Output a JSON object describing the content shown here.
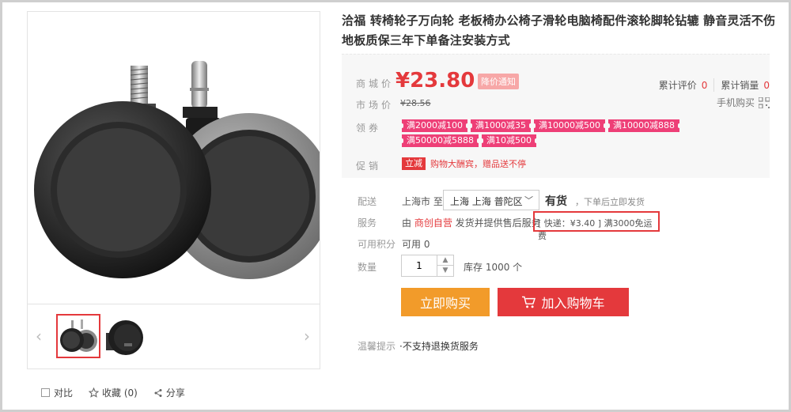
{
  "product": {
    "title": "洽福 转椅轮子万向轮 老板椅办公椅子滑轮电脑椅配件滚轮脚轮钻辘 静音灵活不伤地板质保三年下单备注安装方式"
  },
  "gallery": {
    "prev_icon": "chevron-left-icon",
    "next_icon": "chevron-right-icon"
  },
  "actions": {
    "compare": "对比",
    "favorite": "收藏 (0)",
    "share": "分享"
  },
  "price": {
    "label": "商城价",
    "value": "¥23.80",
    "notice": "降价通知",
    "market_label": "市场价",
    "market_value": "¥28.56"
  },
  "stats": {
    "reviews_label": "累计评价",
    "reviews_count": "0",
    "sales_label": "累计销量",
    "sales_count": "0",
    "mobile_buy": "手机购买"
  },
  "coupons": {
    "label": "领券",
    "items": [
      "满2000减100",
      "满1000减35",
      "满10000减500",
      "满10000减888",
      "满50000减5888",
      "满10减500"
    ]
  },
  "promotion": {
    "label": "促销",
    "tag": "立减",
    "text": "购物大酬宾，赠品送不停"
  },
  "delivery": {
    "label": "配送",
    "from": "上海市 至",
    "area": "上海 上海 普陀区",
    "stock": "有货",
    "note": "，下单后立即发货"
  },
  "service": {
    "label": "服务",
    "prefix": "由 ",
    "seller": "商创自营",
    "suffix": " 发货并提供售后服务",
    "freight": "[ 快递：¥3.40 ]  满3000免运费"
  },
  "points": {
    "label": "可用积分",
    "value": "可用 0"
  },
  "quantity": {
    "label": "数量",
    "value": "1",
    "stock": "库存 1000 个"
  },
  "buttons": {
    "buy_now": "立即购买",
    "add_cart": "加入购物车"
  },
  "tip": {
    "label": "温馨提示",
    "text": "·不支持退换货服务"
  },
  "colors": {
    "accent": "#e4393c",
    "buy": "#f29b2a",
    "coupon": "#ee3f77"
  }
}
